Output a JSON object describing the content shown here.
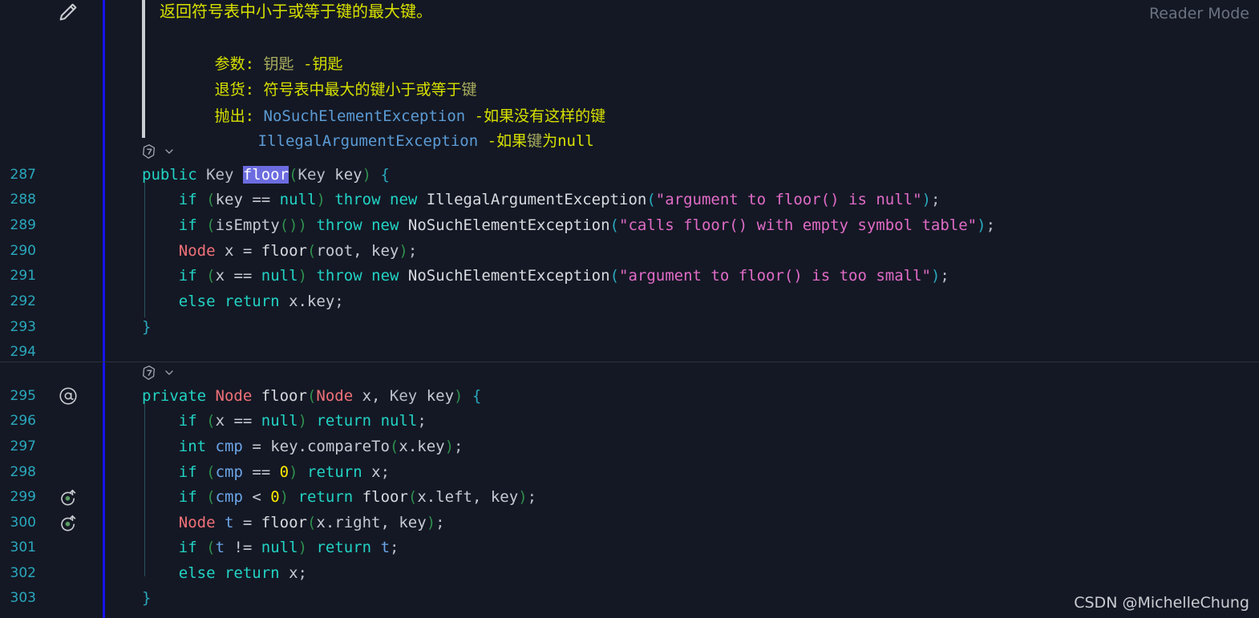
{
  "editor": {
    "background": "#141824",
    "line_number_color": "#2aa8bd",
    "accent_rail_color": "#1414ee",
    "selection_color": "#6c6ce0",
    "reader_mode_label": "Reader Mode",
    "watermark": "CSDN @MichelleChung"
  },
  "gutter": {
    "pencil_icon": "pencil-icon",
    "override_icon": "at-sign-icon",
    "recursion_icon": "recursion-arrow-icon",
    "line_numbers": [
      287,
      288,
      289,
      290,
      291,
      292,
      293,
      294,
      295,
      296,
      297,
      298,
      299,
      300,
      301,
      302,
      303
    ],
    "markers": [
      {
        "line": 295,
        "icon": "at-sign-icon"
      },
      {
        "line": 299,
        "icon": "recursion-arrow-icon"
      },
      {
        "line": 300,
        "icon": "recursion-arrow-icon"
      }
    ]
  },
  "javadoc": {
    "summary": "返回符号表中小于或等于键的最大键。",
    "params_label": "参数:",
    "params_name": "钥匙",
    "params_desc": "-钥匙",
    "returns_label": "退货:",
    "returns_desc": "符号表中最大的键小于或等于",
    "returns_desc_dim": "键",
    "throws_label": "抛出:",
    "throws": [
      {
        "type": "NoSuchElementException",
        "desc": "-如果没有这样的键"
      },
      {
        "type": "IllegalArgumentException",
        "desc_a": "-如果",
        "desc_dim": "键",
        "desc_b": "为null"
      }
    ]
  },
  "code_lens": [
    {
      "icon": "extension-badge-icon",
      "chevron": "chevron-down-icon",
      "above_line": 287
    },
    {
      "icon": "extension-badge-icon",
      "chevron": "chevron-down-icon",
      "above_line": 295
    }
  ],
  "code": {
    "selected_token": "floor",
    "lines": {
      "287": "public Key floor(Key key) {",
      "288": "    if (key == null) throw new IllegalArgumentException(\"argument to floor() is null\");",
      "289": "    if (isEmpty()) throw new NoSuchElementException(\"calls floor() with empty symbol table\");",
      "290": "    Node x = floor(root, key);",
      "291": "    if (x == null) throw new NoSuchElementException(\"argument to floor() is too small\");",
      "292": "    else return x.key;",
      "293": "}",
      "294": "",
      "295": "private Node floor(Node x, Key key) {",
      "296": "    if (x == null) return null;",
      "297": "    int cmp = key.compareTo(x.key);",
      "298": "    if (cmp == 0) return x;",
      "299": "    if (cmp < 0) return floor(x.left, key);",
      "300": "    Node t = floor(x.right, key);",
      "301": "    if (t != null) return t;",
      "302": "    else return x;",
      "303": "}"
    }
  },
  "tokens": {
    "l287": [
      {
        "t": "public ",
        "c": "kw"
      },
      {
        "t": "Key ",
        "c": "typ"
      },
      {
        "t": "floor",
        "c": "sel"
      },
      {
        "t": "(",
        "c": "paren"
      },
      {
        "t": "Key",
        "c": "typ"
      },
      {
        "t": " key",
        "c": "plain"
      },
      {
        "t": ")",
        "c": "paren"
      },
      {
        "t": " ",
        "c": "plain"
      },
      {
        "t": "{",
        "c": "paren2"
      }
    ],
    "l288": [
      {
        "t": "    ",
        "c": "plain"
      },
      {
        "t": "if",
        "c": "kw"
      },
      {
        "t": " ",
        "c": "plain"
      },
      {
        "t": "(",
        "c": "paren"
      },
      {
        "t": "key ",
        "c": "plain"
      },
      {
        "t": "==",
        "c": "plain"
      },
      {
        "t": " ",
        "c": "plain"
      },
      {
        "t": "null",
        "c": "kw"
      },
      {
        "t": ")",
        "c": "paren"
      },
      {
        "t": " ",
        "c": "plain"
      },
      {
        "t": "throw",
        "c": "kw"
      },
      {
        "t": " ",
        "c": "plain"
      },
      {
        "t": "new",
        "c": "kw"
      },
      {
        "t": " ",
        "c": "plain"
      },
      {
        "t": "IllegalArgumentException",
        "c": "fn"
      },
      {
        "t": "(",
        "c": "paren2"
      },
      {
        "t": "\"argument to floor() is null\"",
        "c": "str"
      },
      {
        "t": ")",
        "c": "paren2"
      },
      {
        "t": ";",
        "c": "punc"
      }
    ],
    "l289": [
      {
        "t": "    ",
        "c": "plain"
      },
      {
        "t": "if",
        "c": "kw"
      },
      {
        "t": " ",
        "c": "plain"
      },
      {
        "t": "(",
        "c": "paren"
      },
      {
        "t": "isEmpty",
        "c": "plain"
      },
      {
        "t": "()",
        "c": "paren"
      },
      {
        "t": ")",
        "c": "paren"
      },
      {
        "t": " ",
        "c": "plain"
      },
      {
        "t": "throw",
        "c": "kw"
      },
      {
        "t": " ",
        "c": "plain"
      },
      {
        "t": "new",
        "c": "kw"
      },
      {
        "t": " ",
        "c": "plain"
      },
      {
        "t": "NoSuchElementException",
        "c": "fn"
      },
      {
        "t": "(",
        "c": "paren2"
      },
      {
        "t": "\"calls floor() with empty symbol table\"",
        "c": "str"
      },
      {
        "t": ")",
        "c": "paren2"
      },
      {
        "t": ";",
        "c": "punc"
      }
    ],
    "l290": [
      {
        "t": "    ",
        "c": "plain"
      },
      {
        "t": "Node",
        "c": "cls"
      },
      {
        "t": " x ",
        "c": "plain"
      },
      {
        "t": "=",
        "c": "plain"
      },
      {
        "t": " ",
        "c": "plain"
      },
      {
        "t": "floor",
        "c": "fn"
      },
      {
        "t": "(",
        "c": "paren"
      },
      {
        "t": "root, key",
        "c": "plain"
      },
      {
        "t": ")",
        "c": "paren"
      },
      {
        "t": ";",
        "c": "punc"
      }
    ],
    "l291": [
      {
        "t": "    ",
        "c": "plain"
      },
      {
        "t": "if",
        "c": "kw"
      },
      {
        "t": " ",
        "c": "plain"
      },
      {
        "t": "(",
        "c": "paren"
      },
      {
        "t": "x ",
        "c": "plain"
      },
      {
        "t": "==",
        "c": "plain"
      },
      {
        "t": " ",
        "c": "plain"
      },
      {
        "t": "null",
        "c": "kw"
      },
      {
        "t": ")",
        "c": "paren"
      },
      {
        "t": " ",
        "c": "plain"
      },
      {
        "t": "throw",
        "c": "kw"
      },
      {
        "t": " ",
        "c": "plain"
      },
      {
        "t": "new",
        "c": "kw"
      },
      {
        "t": " ",
        "c": "plain"
      },
      {
        "t": "NoSuchElementException",
        "c": "fn"
      },
      {
        "t": "(",
        "c": "paren2"
      },
      {
        "t": "\"argument to floor() is too small\"",
        "c": "str"
      },
      {
        "t": ")",
        "c": "paren2"
      },
      {
        "t": ";",
        "c": "punc"
      }
    ],
    "l292": [
      {
        "t": "    ",
        "c": "plain"
      },
      {
        "t": "else",
        "c": "kw"
      },
      {
        "t": " ",
        "c": "plain"
      },
      {
        "t": "return",
        "c": "kw"
      },
      {
        "t": " x.key",
        "c": "plain"
      },
      {
        "t": ";",
        "c": "punc"
      }
    ],
    "l293": [
      {
        "t": "}",
        "c": "paren2"
      }
    ],
    "l295": [
      {
        "t": "private ",
        "c": "kw"
      },
      {
        "t": "Node",
        "c": "cls"
      },
      {
        "t": " ",
        "c": "plain"
      },
      {
        "t": "floor",
        "c": "fn"
      },
      {
        "t": "(",
        "c": "paren"
      },
      {
        "t": "Node",
        "c": "cls"
      },
      {
        "t": " x, ",
        "c": "plain"
      },
      {
        "t": "Key",
        "c": "typ"
      },
      {
        "t": " key",
        "c": "plain"
      },
      {
        "t": ")",
        "c": "paren"
      },
      {
        "t": " ",
        "c": "plain"
      },
      {
        "t": "{",
        "c": "paren2"
      }
    ],
    "l296": [
      {
        "t": "    ",
        "c": "plain"
      },
      {
        "t": "if",
        "c": "kw"
      },
      {
        "t": " ",
        "c": "plain"
      },
      {
        "t": "(",
        "c": "paren"
      },
      {
        "t": "x ",
        "c": "plain"
      },
      {
        "t": "==",
        "c": "plain"
      },
      {
        "t": " ",
        "c": "plain"
      },
      {
        "t": "null",
        "c": "kw"
      },
      {
        "t": ")",
        "c": "paren"
      },
      {
        "t": " ",
        "c": "plain"
      },
      {
        "t": "return",
        "c": "kw"
      },
      {
        "t": " ",
        "c": "plain"
      },
      {
        "t": "null",
        "c": "kw"
      },
      {
        "t": ";",
        "c": "punc"
      }
    ],
    "l297": [
      {
        "t": "    ",
        "c": "plain"
      },
      {
        "t": "int",
        "c": "kw"
      },
      {
        "t": " ",
        "c": "plain"
      },
      {
        "t": "cmp",
        "c": "var"
      },
      {
        "t": " = ",
        "c": "plain"
      },
      {
        "t": "key.compareTo",
        "c": "plain"
      },
      {
        "t": "(",
        "c": "paren"
      },
      {
        "t": "x.key",
        "c": "plain"
      },
      {
        "t": ")",
        "c": "paren"
      },
      {
        "t": ";",
        "c": "punc"
      }
    ],
    "l298": [
      {
        "t": "    ",
        "c": "plain"
      },
      {
        "t": "if",
        "c": "kw"
      },
      {
        "t": " ",
        "c": "plain"
      },
      {
        "t": "(",
        "c": "paren"
      },
      {
        "t": "cmp",
        "c": "var"
      },
      {
        "t": " ==",
        "c": "plain"
      },
      {
        "t": " ",
        "c": "plain"
      },
      {
        "t": "0",
        "c": "num"
      },
      {
        "t": ")",
        "c": "paren"
      },
      {
        "t": " ",
        "c": "plain"
      },
      {
        "t": "return",
        "c": "kw"
      },
      {
        "t": " x",
        "c": "plain"
      },
      {
        "t": ";",
        "c": "punc"
      }
    ],
    "l299": [
      {
        "t": "    ",
        "c": "plain"
      },
      {
        "t": "if",
        "c": "kw"
      },
      {
        "t": " ",
        "c": "plain"
      },
      {
        "t": "(",
        "c": "paren"
      },
      {
        "t": "cmp",
        "c": "var"
      },
      {
        "t": " <",
        "c": "plain"
      },
      {
        "t": " ",
        "c": "plain"
      },
      {
        "t": "0",
        "c": "num"
      },
      {
        "t": ")",
        "c": "paren"
      },
      {
        "t": " ",
        "c": "plain"
      },
      {
        "t": "return",
        "c": "kw"
      },
      {
        "t": " ",
        "c": "plain"
      },
      {
        "t": "floor",
        "c": "fn"
      },
      {
        "t": "(",
        "c": "paren"
      },
      {
        "t": "x.left, key",
        "c": "plain"
      },
      {
        "t": ")",
        "c": "paren"
      },
      {
        "t": ";",
        "c": "punc"
      }
    ],
    "l300": [
      {
        "t": "    ",
        "c": "plain"
      },
      {
        "t": "Node",
        "c": "cls"
      },
      {
        "t": " ",
        "c": "plain"
      },
      {
        "t": "t",
        "c": "var"
      },
      {
        "t": " = ",
        "c": "plain"
      },
      {
        "t": "floor",
        "c": "fn"
      },
      {
        "t": "(",
        "c": "paren"
      },
      {
        "t": "x.right, key",
        "c": "plain"
      },
      {
        "t": ")",
        "c": "paren"
      },
      {
        "t": ";",
        "c": "punc"
      }
    ],
    "l301": [
      {
        "t": "    ",
        "c": "plain"
      },
      {
        "t": "if",
        "c": "kw"
      },
      {
        "t": " ",
        "c": "plain"
      },
      {
        "t": "(",
        "c": "paren"
      },
      {
        "t": "t",
        "c": "var"
      },
      {
        "t": " !=",
        "c": "plain"
      },
      {
        "t": " ",
        "c": "plain"
      },
      {
        "t": "null",
        "c": "kw"
      },
      {
        "t": ")",
        "c": "paren"
      },
      {
        "t": " ",
        "c": "plain"
      },
      {
        "t": "return",
        "c": "kw"
      },
      {
        "t": " ",
        "c": "plain"
      },
      {
        "t": "t",
        "c": "var"
      },
      {
        "t": ";",
        "c": "punc"
      }
    ],
    "l302": [
      {
        "t": "    ",
        "c": "plain"
      },
      {
        "t": "else",
        "c": "kw"
      },
      {
        "t": " ",
        "c": "plain"
      },
      {
        "t": "return",
        "c": "kw"
      },
      {
        "t": " x",
        "c": "plain"
      },
      {
        "t": ";",
        "c": "punc"
      }
    ],
    "l303": [
      {
        "t": "}",
        "c": "paren2"
      }
    ]
  }
}
